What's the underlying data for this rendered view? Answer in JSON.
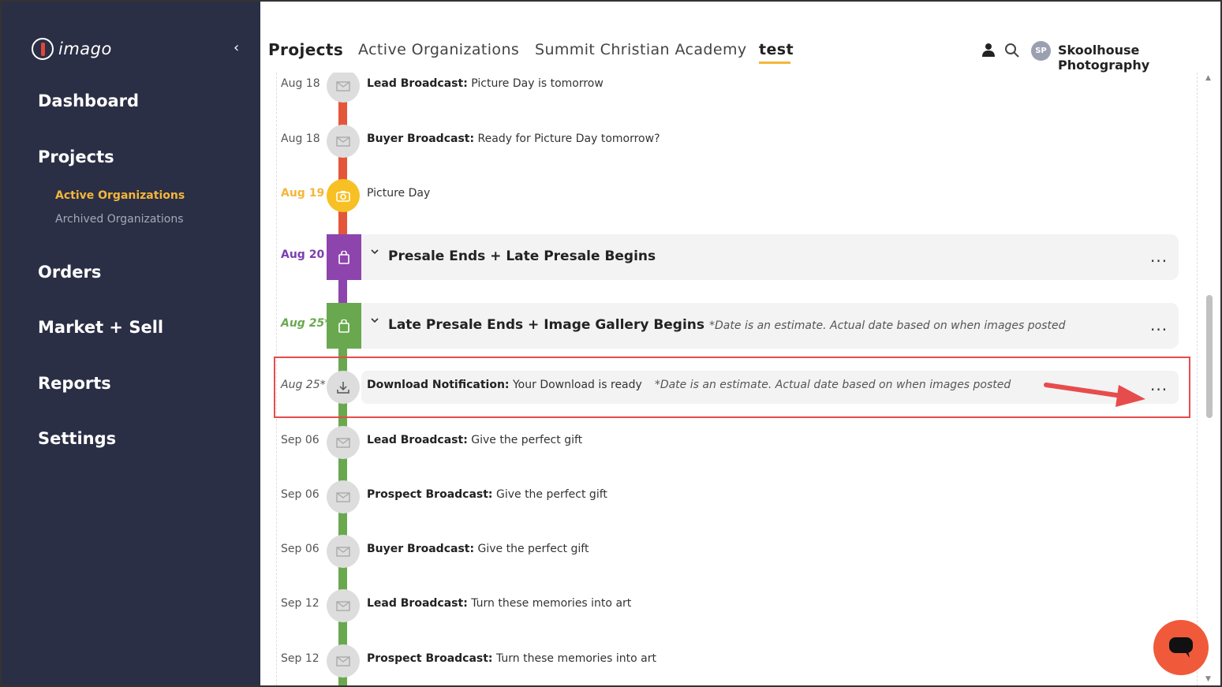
{
  "sidebar": {
    "logo_text": "imago",
    "nav": {
      "dashboard": "Dashboard",
      "projects": "Projects",
      "active_orgs": "Active Organizations",
      "archived_orgs": "Archived Organizations",
      "orders": "Orders",
      "market_sell": "Market + Sell",
      "reports": "Reports",
      "settings": "Settings"
    }
  },
  "header": {
    "breadcrumb": [
      "Projects",
      "Active Organizations",
      "Summit Christian Academy",
      "test"
    ],
    "avatar_initials": "SP",
    "studio_name": "Skoolhouse Photography"
  },
  "timeline": {
    "rows": [
      {
        "date": "Aug 18",
        "label": "Lead Broadcast:",
        "text": "Picture Day is tomorrow",
        "icon": "envelope-icon"
      },
      {
        "date": "Aug 18",
        "label": "Buyer Broadcast:",
        "text": "Ready for Picture Day tomorrow?",
        "icon": "envelope-icon"
      },
      {
        "date": "Aug 19",
        "label": "",
        "text": "Picture Day",
        "icon": "camera-icon"
      },
      {
        "date": "Aug 20",
        "title": "Presale Ends + Late Presale Begins",
        "icon": "bag-icon"
      },
      {
        "date": "Aug 25*",
        "title": "Late Presale Ends + Image Gallery Begins",
        "note": "*Date is an estimate. Actual date based on when images posted",
        "icon": "bag-icon"
      },
      {
        "date": "Aug 25*",
        "label": "Download Notification:",
        "text": "Your Download is ready",
        "note": "*Date is an estimate. Actual date based on when images posted",
        "icon": "download-icon"
      },
      {
        "date": "Sep 06",
        "label": "Lead Broadcast:",
        "text": "Give the perfect gift",
        "icon": "envelope-icon"
      },
      {
        "date": "Sep 06",
        "label": "Prospect Broadcast:",
        "text": "Give the perfect gift",
        "icon": "envelope-icon"
      },
      {
        "date": "Sep 06",
        "label": "Buyer Broadcast:",
        "text": "Give the perfect gift",
        "icon": "envelope-icon"
      },
      {
        "date": "Sep 12",
        "label": "Lead Broadcast:",
        "text": "Turn these memories into art",
        "icon": "envelope-icon"
      },
      {
        "date": "Sep 12",
        "label": "Prospect Broadcast:",
        "text": "Turn these memories into art",
        "icon": "envelope-icon"
      }
    ],
    "menu_label": "..."
  },
  "colors": {
    "sidebar_bg": "#2b2f45",
    "accent_yellow": "#f4b63a",
    "line_red": "#e4563a",
    "line_purple": "#8e44ad",
    "line_green": "#6aa84f",
    "highlight_red": "#e74c4c",
    "chat_button": "#f05a3a"
  }
}
